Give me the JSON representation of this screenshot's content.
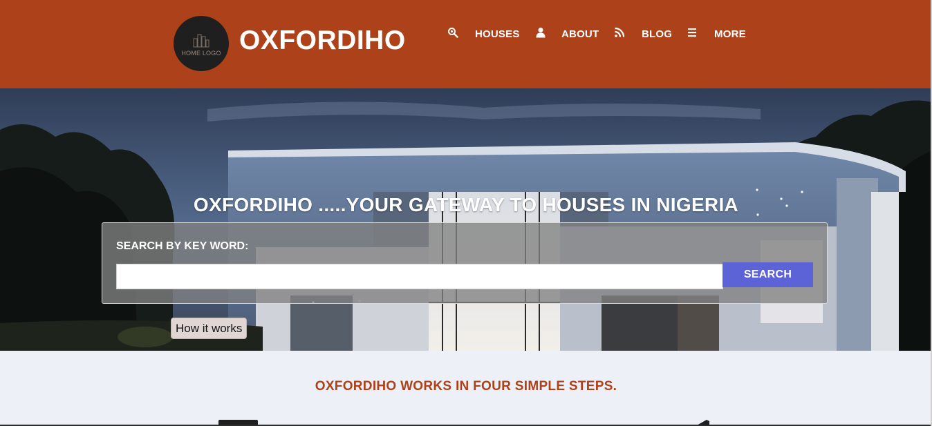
{
  "header": {
    "logo_text": "HOME LOGO",
    "brand": "OXFORDIHO",
    "nav": [
      {
        "icon": "search-icon",
        "label": "HOUSES"
      },
      {
        "icon": "user-icon",
        "label": "ABOUT"
      },
      {
        "icon": "rss-icon",
        "label": "BLOG"
      },
      {
        "icon": "menu-icon",
        "label": "MORE"
      }
    ]
  },
  "hero": {
    "title": "OXFORDIHO .....YOUR GATEWAY TO HOUSES IN NIGERIA",
    "search_label": "SEARCH BY KEY WORD:",
    "search_value": "",
    "search_placeholder": "",
    "search_button": "SEARCH",
    "how_button": "How it works"
  },
  "steps": {
    "title": "OXFORDIHO WORKS IN FOUR SIMPLE STEPS."
  },
  "colors": {
    "header_bg": "#ad4119",
    "accent_button": "#5c63d6",
    "steps_title": "#ad4119",
    "section_bg": "#eef0f8"
  }
}
